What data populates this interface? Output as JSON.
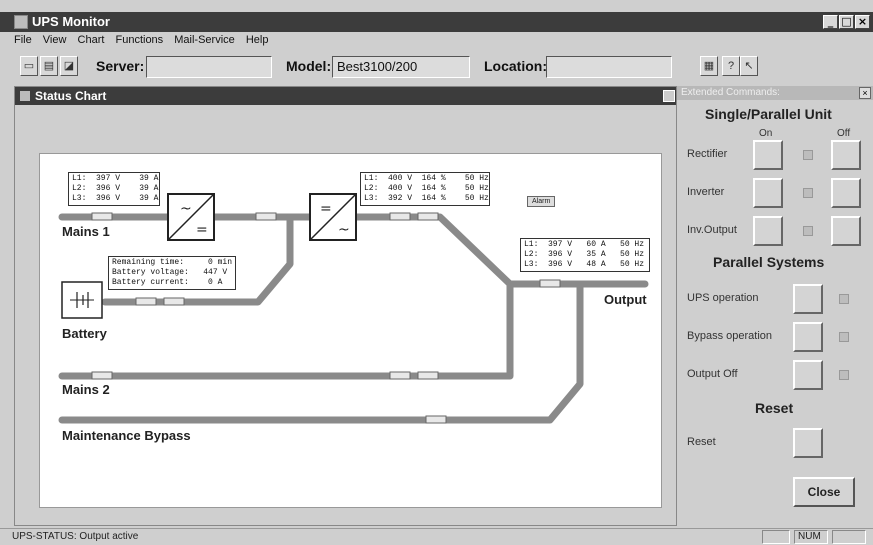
{
  "window": {
    "title": "UPS Monitor"
  },
  "menu": [
    "File",
    "View",
    "Chart",
    "Functions",
    "Mail-Service",
    "Help"
  ],
  "toolbar": {
    "server_label": "Server:",
    "server_value": "",
    "model_label": "Model:",
    "model_value": "Best3100/200",
    "location_label": "Location:",
    "location_value": ""
  },
  "status_chart": {
    "title": "Status Chart",
    "labels": {
      "mains1": "Mains 1",
      "battery": "Battery",
      "mains2": "Mains 2",
      "bypass": "Maintenance Bypass",
      "output": "Output",
      "alarm": "Alarm"
    },
    "mains1_box": [
      "L1:  397 V    39 A",
      "L2:  396 V    39 A",
      "L3:  396 V    39 A"
    ],
    "inverter_box": [
      "L1:  400 V  164 %    50 Hz",
      "L2:  400 V  164 %    50 Hz",
      "L3:  392 V  164 %    50 Hz"
    ],
    "output_box": [
      "L1:  397 V   60 A   50 Hz",
      "L2:  396 V   35 A   50 Hz",
      "L3:  396 V   48 A   50 Hz"
    ],
    "battery_box": [
      "Remaining time:     0 min",
      "Battery voltage:   447 V",
      "Battery current:    0 A"
    ]
  },
  "extended": {
    "title": "Extended Commands:",
    "single_parallel_title": "Single/Parallel Unit",
    "on_label": "On",
    "off_label": "Off",
    "rectifier": "Rectifier",
    "inverter": "Inverter",
    "inv_output": "Inv.Output",
    "parallel_title": "Parallel Systems",
    "ups_operation": "UPS operation",
    "bypass_operation": "Bypass operation",
    "output_off": "Output Off",
    "reset_title": "Reset",
    "reset_label": "Reset",
    "close_label": "Close"
  },
  "statusbar": {
    "text": "UPS-STATUS: Output active",
    "num": "NUM"
  },
  "colors": {
    "titlebar": "#3c3c3c",
    "pipe": "#8a8a8a",
    "canvas": "#ffffff"
  },
  "icons": [
    "app-icon",
    "open-icon",
    "print-icon",
    "chart-icon",
    "help-icon",
    "help-pointer-icon",
    "rectifier-icon",
    "inverter-icon",
    "battery-icon"
  ]
}
